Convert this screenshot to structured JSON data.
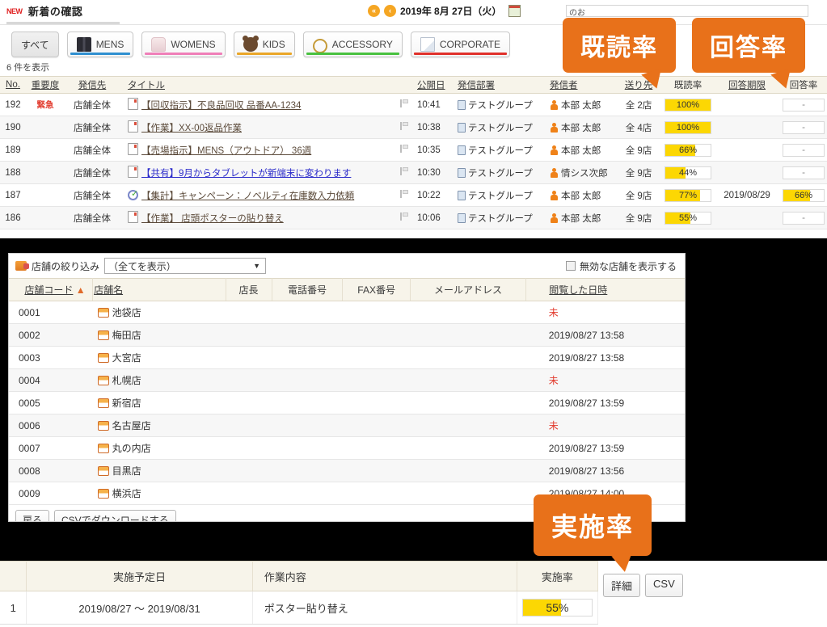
{
  "new_panel": {
    "badge": "NEW",
    "title": "新着の確認",
    "date": "2019年 8月 27日（火）",
    "nav_first": "«",
    "nav_prev": "‹",
    "hidden_field": "のお",
    "count_text": "6 件を表示",
    "tabs": [
      {
        "label": "すべて",
        "icon": "",
        "accent": "",
        "active": true
      },
      {
        "label": "MENS",
        "icon": "mens-icon",
        "accent": "#2f8fd0",
        "active": false
      },
      {
        "label": "WOMENS",
        "icon": "womens-icon",
        "accent": "#ef7fb8",
        "active": false
      },
      {
        "label": "KIDS",
        "icon": "kids-icon",
        "accent": "#eaa628",
        "active": false
      },
      {
        "label": "ACCESSORY",
        "icon": "accessory-icon",
        "accent": "#48c13f",
        "active": false
      },
      {
        "label": "CORPORATE",
        "icon": "corporate-icon",
        "accent": "#e0302a",
        "active": false
      }
    ],
    "columns": [
      "No.",
      "重要度",
      "発信先",
      "タイトル",
      "公開日",
      "発信部署",
      "発信者",
      "送り先",
      "既読率",
      "回答期限",
      "回答率"
    ],
    "rows": [
      {
        "no": "192",
        "priority": "緊急",
        "dest": "店舗全体",
        "title": "【回収指示】不良品回収 品番AA-1234",
        "title_icon": "document-icon",
        "title_blue": false,
        "time": "10:41",
        "dept": "テストグループ",
        "sender": "本部 太郎",
        "to": "全 2店",
        "read_rate": "100%",
        "read_value": 100,
        "answer_limit": "",
        "answer_rate": "-",
        "answer_value": null
      },
      {
        "no": "190",
        "priority": "",
        "dest": "店舗全体",
        "title": "【作業】XX-00返品作業",
        "title_icon": "document-icon",
        "title_blue": false,
        "time": "10:38",
        "dept": "テストグループ",
        "sender": "本部 太郎",
        "to": "全 4店",
        "read_rate": "100%",
        "read_value": 100,
        "answer_limit": "",
        "answer_rate": "-",
        "answer_value": null
      },
      {
        "no": "189",
        "priority": "",
        "dest": "店舗全体",
        "title": "【売場指示】MENS（アウトドア） 36週",
        "title_icon": "document-icon",
        "title_blue": false,
        "time": "10:35",
        "dept": "テストグループ",
        "sender": "本部 太郎",
        "to": "全 9店",
        "read_rate": "66%",
        "read_value": 66,
        "answer_limit": "",
        "answer_rate": "-",
        "answer_value": null
      },
      {
        "no": "188",
        "priority": "",
        "dest": "店舗全体",
        "title": "【共有】9月からタブレットが新端末に変わります",
        "title_icon": "document-icon",
        "title_blue": true,
        "time": "10:30",
        "dept": "テストグループ",
        "sender": "情シス次郎",
        "to": "全 9店",
        "read_rate": "44%",
        "read_value": 44,
        "answer_limit": "",
        "answer_rate": "-",
        "answer_value": null
      },
      {
        "no": "187",
        "priority": "",
        "dest": "店舗全体",
        "title": "【集計】キャンペーン：ノベルティ在庫数入力依頼",
        "title_icon": "survey-icon",
        "title_blue": false,
        "time": "10:22",
        "dept": "テストグループ",
        "sender": "本部 太郎",
        "to": "全 9店",
        "read_rate": "77%",
        "read_value": 77,
        "answer_limit": "2019/08/29",
        "answer_rate": "66%",
        "answer_value": 66
      },
      {
        "no": "186",
        "priority": "",
        "dest": "店舗全体",
        "title": "【作業】 店頭ポスターの貼り替え",
        "title_icon": "document-icon",
        "title_blue": false,
        "time": "10:06",
        "dept": "テストグループ",
        "sender": "本部 太郎",
        "to": "全 9店",
        "read_rate": "55%",
        "read_value": 55,
        "answer_limit": "",
        "answer_rate": "-",
        "answer_value": null
      }
    ]
  },
  "store_panel": {
    "filter_label": "店舗の絞り込み",
    "filter_value": "（全てを表示）",
    "caret": "▼",
    "checkbox_label": "無効な店舗を表示する",
    "columns": [
      "店舗コード",
      "店舗名",
      "店長",
      "電話番号",
      "FAX番号",
      "メールアドレス",
      "閲覧した日時"
    ],
    "rows": [
      {
        "code": "0001",
        "name": "池袋店",
        "manager": "",
        "tel": "",
        "fax": "",
        "mail": "",
        "viewed": "未",
        "unread": true
      },
      {
        "code": "0002",
        "name": "梅田店",
        "manager": "",
        "tel": "",
        "fax": "",
        "mail": "",
        "viewed": "2019/08/27 13:58",
        "unread": false
      },
      {
        "code": "0003",
        "name": "大宮店",
        "manager": "",
        "tel": "",
        "fax": "",
        "mail": "",
        "viewed": "2019/08/27 13:58",
        "unread": false
      },
      {
        "code": "0004",
        "name": "札幌店",
        "manager": "",
        "tel": "",
        "fax": "",
        "mail": "",
        "viewed": "未",
        "unread": true
      },
      {
        "code": "0005",
        "name": "新宿店",
        "manager": "",
        "tel": "",
        "fax": "",
        "mail": "",
        "viewed": "2019/08/27 13:59",
        "unread": false
      },
      {
        "code": "0006",
        "name": "名古屋店",
        "manager": "",
        "tel": "",
        "fax": "",
        "mail": "",
        "viewed": "未",
        "unread": true
      },
      {
        "code": "0007",
        "name": "丸の内店",
        "manager": "",
        "tel": "",
        "fax": "",
        "mail": "",
        "viewed": "2019/08/27 13:59",
        "unread": false
      },
      {
        "code": "0008",
        "name": "目黒店",
        "manager": "",
        "tel": "",
        "fax": "",
        "mail": "",
        "viewed": "2019/08/27 13:56",
        "unread": false
      },
      {
        "code": "0009",
        "name": "横浜店",
        "manager": "",
        "tel": "",
        "fax": "",
        "mail": "",
        "viewed": "2019/08/27 14:00",
        "unread": false
      }
    ],
    "back_button": "戻る",
    "csv_button": "CSVでダウンロードする"
  },
  "task_panel": {
    "columns": [
      "実施予定日",
      "作業内容",
      "実施率"
    ],
    "rows": [
      {
        "index": "1",
        "date": "2019/08/27 ～ 2019/08/31",
        "work": "ポスター貼り替え",
        "rate": "55%",
        "rate_value": 55
      }
    ],
    "detail_button": "詳細",
    "csv_button": "CSV"
  },
  "callouts": {
    "read_rate": "既読率",
    "answer_rate": "回答率",
    "implementation_rate": "実施率"
  },
  "colors": {
    "accent_orange": "#e8711a",
    "rate_yellow": "#fcd703",
    "urgent_red": "#e23b2e",
    "header_beige": "#f7f4ea",
    "link_brown": "#5b4a3a",
    "link_blue": "#2a2aca"
  }
}
